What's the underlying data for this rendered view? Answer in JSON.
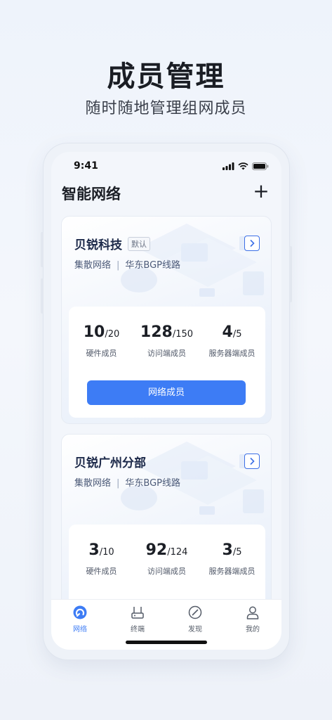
{
  "promo": {
    "title": "成员管理",
    "subtitle": "随时随地管理组网成员"
  },
  "status_bar": {
    "time": "9:41"
  },
  "header": {
    "title": "智能网络",
    "add_label": "+"
  },
  "networks": [
    {
      "name": "贝锐科技",
      "tag": "默认",
      "type": "集散网络",
      "separator": "|",
      "line": "华东BGP线路",
      "stats": [
        {
          "value": "10",
          "total": "/20",
          "label": "硬件成员"
        },
        {
          "value": "128",
          "total": "/150",
          "label": "访问端成员"
        },
        {
          "value": "4",
          "total": "/5",
          "label": "服务器端成员"
        }
      ],
      "button_label": "网络成员"
    },
    {
      "name": "贝锐广州分部",
      "type": "集散网络",
      "separator": "|",
      "line": "华东BGP线路",
      "stats": [
        {
          "value": "3",
          "total": "/10",
          "label": "硬件成员"
        },
        {
          "value": "92",
          "total": "/124",
          "label": "访问端成员"
        },
        {
          "value": "3",
          "total": "/5",
          "label": "服务器端成员"
        }
      ]
    }
  ],
  "tabs": [
    {
      "label": "网络",
      "icon": "network-icon",
      "active": true
    },
    {
      "label": "终端",
      "icon": "router-icon",
      "active": false
    },
    {
      "label": "发现",
      "icon": "compass-icon",
      "active": false
    },
    {
      "label": "我的",
      "icon": "person-icon",
      "active": false
    }
  ],
  "colors": {
    "accent": "#3d7cf5",
    "text_dark": "#1c1f26",
    "sub_text": "#4c5a78"
  }
}
